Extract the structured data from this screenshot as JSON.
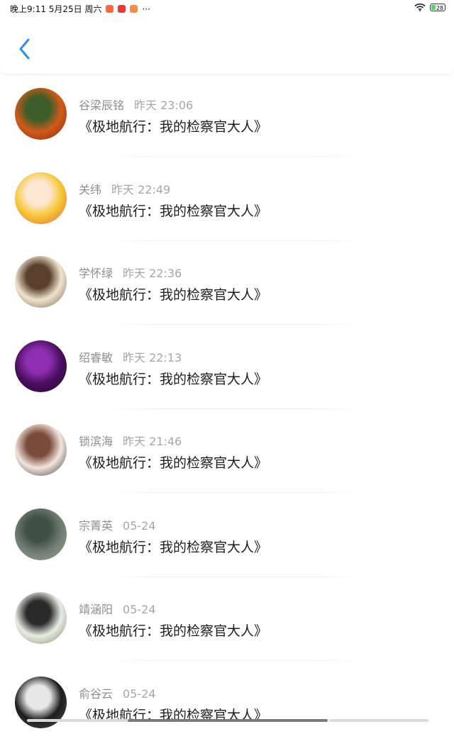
{
  "status_bar": {
    "left_text": "晚上9:11 5月25日 周六",
    "more": "···",
    "battery": "28",
    "notif_colors": [
      "#ff6a3d",
      "#e53935",
      "#ff8a3d"
    ],
    "battery_fill_level": 0.28
  },
  "header": {
    "back_icon": "chevron-left-icon",
    "accent": "#2f8ee8"
  },
  "comments": [
    {
      "user": "谷梁辰铭",
      "time": "昨天 23:06",
      "title": "《极地航行：我的检察官大人》",
      "avatar_colors": [
        "#d25a1b",
        "#3a5d2a",
        "#7a2a10"
      ]
    },
    {
      "user": "关纬",
      "time": "昨天 22:49",
      "title": "《极地航行：我的检察官大人》",
      "avatar_colors": [
        "#f6c735",
        "#fde7d3",
        "#e25b4a"
      ]
    },
    {
      "user": "学怀绿",
      "time": "昨天 22:36",
      "title": "《极地航行：我的检察官大人》",
      "avatar_colors": [
        "#efe4cf",
        "#5a3f2c",
        "#7a5a3e"
      ]
    },
    {
      "user": "绍睿敏",
      "time": "昨天 22:13",
      "title": "《极地航行：我的检察官大人》",
      "avatar_colors": [
        "#4a0e5e",
        "#8d2fb0",
        "#21052c"
      ]
    },
    {
      "user": "锁滨海",
      "time": "昨天 21:46",
      "title": "《极地航行：我的检察官大人》",
      "avatar_colors": [
        "#f3e4df",
        "#7a4b3a",
        "#2b2b2b"
      ]
    },
    {
      "user": "宗菁英",
      "time": "05-24",
      "title": "《极地航行：我的检察官大人》",
      "avatar_colors": [
        "#6f7d70",
        "#3f4f43",
        "#9aa39a"
      ]
    },
    {
      "user": "靖涵阳",
      "time": "05-24",
      "title": "《极地航行：我的检察官大人》",
      "avatar_colors": [
        "#e9ece4",
        "#2a2a2a",
        "#6f8a5a"
      ]
    },
    {
      "user": "俞谷云",
      "time": "05-24",
      "title": "《极地航行：我的检察官大人》",
      "avatar_colors": [
        "#1d1d1d",
        "#e7e7e7",
        "#555"
      ]
    }
  ]
}
